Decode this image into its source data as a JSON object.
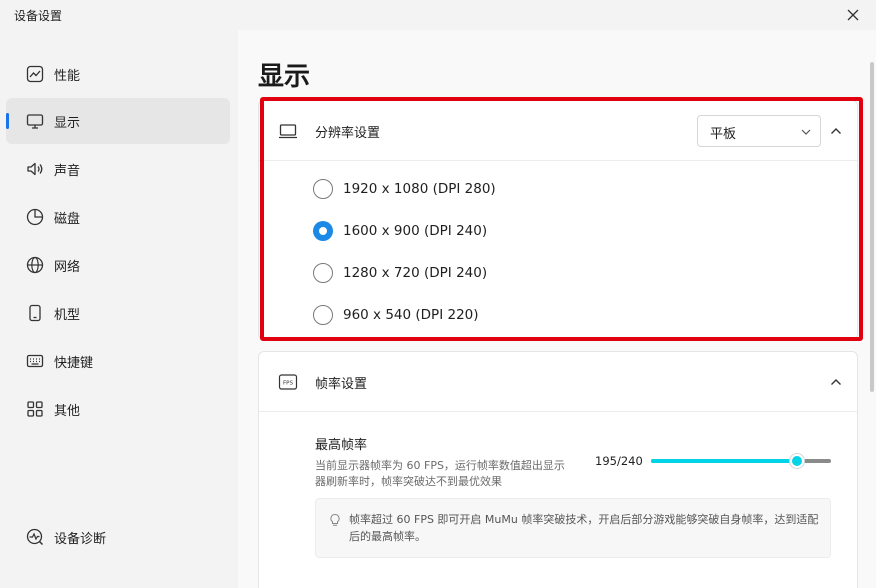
{
  "window": {
    "title": "设备设置"
  },
  "sidebar": {
    "items": [
      {
        "label": "性能",
        "icon": "performance-chart-icon"
      },
      {
        "label": "显示",
        "icon": "monitor-icon",
        "active": true
      },
      {
        "label": "声音",
        "icon": "speaker-icon"
      },
      {
        "label": "磁盘",
        "icon": "disk-pie-icon"
      },
      {
        "label": "网络",
        "icon": "globe-icon"
      },
      {
        "label": "机型",
        "icon": "phone-icon"
      },
      {
        "label": "快捷键",
        "icon": "keyboard-icon"
      },
      {
        "label": "其他",
        "icon": "grid-icon"
      }
    ],
    "diagnostics": {
      "label": "设备诊断",
      "icon": "diagnostics-icon"
    }
  },
  "main": {
    "title": "显示",
    "resolution": {
      "title": "分辨率设置",
      "mode_select": {
        "value": "平板"
      },
      "options": [
        {
          "label": "1920 x 1080 (DPI 280)",
          "checked": false
        },
        {
          "label": "1600 x 900 (DPI 240)",
          "checked": true
        },
        {
          "label": "1280 x 720 (DPI 240)",
          "checked": false
        },
        {
          "label": "960 x 540 (DPI 220)",
          "checked": false
        }
      ]
    },
    "framerate": {
      "title": "帧率设置",
      "icon_text": "FPS",
      "max_fps": {
        "title": "最高帧率",
        "description": "当前显示器帧率为 60 FPS，运行帧率数值超出显示器刷新率时，帧率突破达不到最优效果",
        "value_text": "195/240",
        "value": 195,
        "max": 240
      },
      "tip": "帧率超过 60 FPS 即可开启 MuMu 帧率突破技术，开启后部分游戏能够突破自身帧率，达到适配后的最高帧率。"
    }
  },
  "colors": {
    "accent": "#1a8ae6",
    "slider": "#00d4e6",
    "highlight": "#e0000f"
  }
}
